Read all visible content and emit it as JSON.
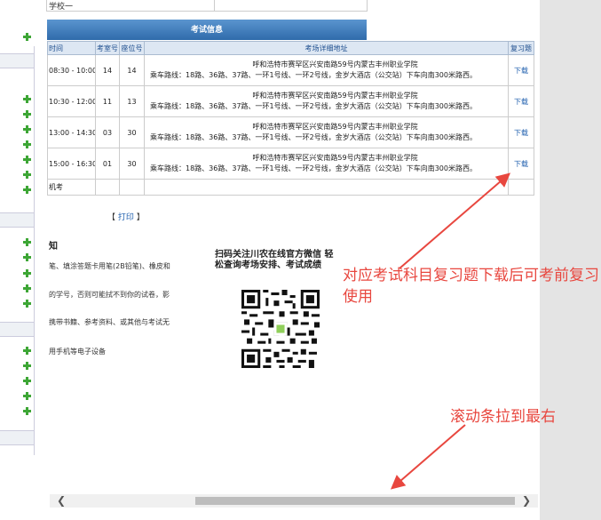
{
  "top_row": {
    "label": "学校一"
  },
  "exam_info": {
    "title": "考试信息",
    "headers": {
      "time": "时间",
      "room": "考室号",
      "seat": "座位号",
      "address": "考场详细地址",
      "review": "复习题"
    },
    "rows": [
      {
        "time": "08:30 - 10:00",
        "room": "14",
        "seat": "14",
        "addr1": "呼和浩特市赛罕区兴安南路59号内蒙古丰州职业学院",
        "addr2": "乘车路线：18路、36路、37路、一环1号线、一环2号线，金岁大酒店（公交站）下车向南300米路西。",
        "review": "下载"
      },
      {
        "time": "10:30 - 12:00",
        "room": "11",
        "seat": "13",
        "addr1": "呼和浩特市赛罕区兴安南路59号内蒙古丰州职业学院",
        "addr2": "乘车路线：18路、36路、37路、一环1号线、一环2号线，金岁大酒店（公交站）下车向南300米路西。",
        "review": "下载"
      },
      {
        "time": "13:00 - 14:30",
        "room": "03",
        "seat": "30",
        "addr1": "呼和浩特市赛罕区兴安南路59号内蒙古丰州职业学院",
        "addr2": "乘车路线：18路、36路、37路、一环1号线、一环2号线，金岁大酒店（公交站）下车向南300米路西。",
        "review": "下载"
      },
      {
        "time": "15:00 - 16:30",
        "room": "01",
        "seat": "30",
        "addr1": "呼和浩特市赛罕区兴安南路59号内蒙古丰州职业学院",
        "addr2": "乘车路线：18路、36路、37路、一环1号线、一环2号线，金岁大酒店（公交站）下车向南300米路西。",
        "review": "下载"
      }
    ],
    "last_row": "机考"
  },
  "print_label": "【 打印 】",
  "print_inner": "打印",
  "notice": {
    "title": "知",
    "lines": [
      "笔、填涂答题卡用笔(2B铅笔)、橡皮和",
      "的学号，否则可能拭不到你的试卷，影",
      "携带书籍、参考资料、或其他与考试无",
      "用手机等电子设备"
    ]
  },
  "qr": {
    "title": "扫码关注川农在线官方微信 轻松查询考场安排、考试成绩"
  },
  "annotations": {
    "review_download": "对应考试科目复习题下载后可考前复习使用",
    "scroll_right": "滚动条拉到最右"
  },
  "scrollbar": {
    "left_icon": "chevron-left-icon",
    "right_icon": "chevron-right-icon",
    "position": 1.0
  },
  "colors": {
    "accent": "#2f6bab",
    "annotation": "#e8473f",
    "plus": "#3da635"
  }
}
